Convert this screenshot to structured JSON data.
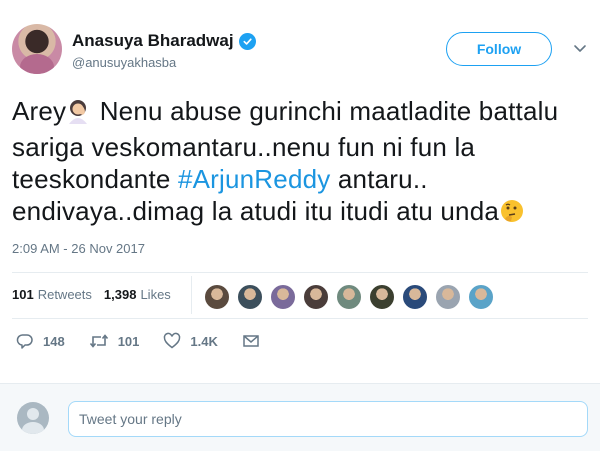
{
  "user": {
    "display_name": "Anasuya Bharadwaj",
    "handle": "@anusuyakhasba",
    "verified": true
  },
  "header": {
    "follow_label": "Follow"
  },
  "tweet": {
    "text_parts": [
      "Arey",
      " Nenu abuse gurinchi maatladite battalu sariga veskomantaru..nenu fun ni fun la teeskondante ",
      "#ArjunReddy",
      " antaru.. endivaya..dimag la atudi itu itudi atu unda"
    ],
    "emojis": [
      "woman-facepalming-emoji",
      "thinking-face-emoji"
    ],
    "timestamp": "2:09 AM - 26 Nov 2017"
  },
  "stats": {
    "retweets_count": "101",
    "retweets_label": "Retweets",
    "likes_count": "1,398",
    "likes_label": "Likes",
    "liker_colors": [
      "#5a4a3e",
      "#3c4f5c",
      "#7a6a9a",
      "#4a3d3a",
      "#6f8a7e",
      "#3b3f2f",
      "#2a4a7a",
      "#9aa4b0",
      "#5aa3c8"
    ]
  },
  "actions": {
    "reply_count": "148",
    "retweet_count": "101",
    "like_count": "1.4K"
  },
  "reply": {
    "placeholder": "Tweet your reply"
  },
  "colors": {
    "brand_blue": "#1da1f2",
    "hashtag_blue": "#1b95e0",
    "muted_text": "#657786"
  }
}
